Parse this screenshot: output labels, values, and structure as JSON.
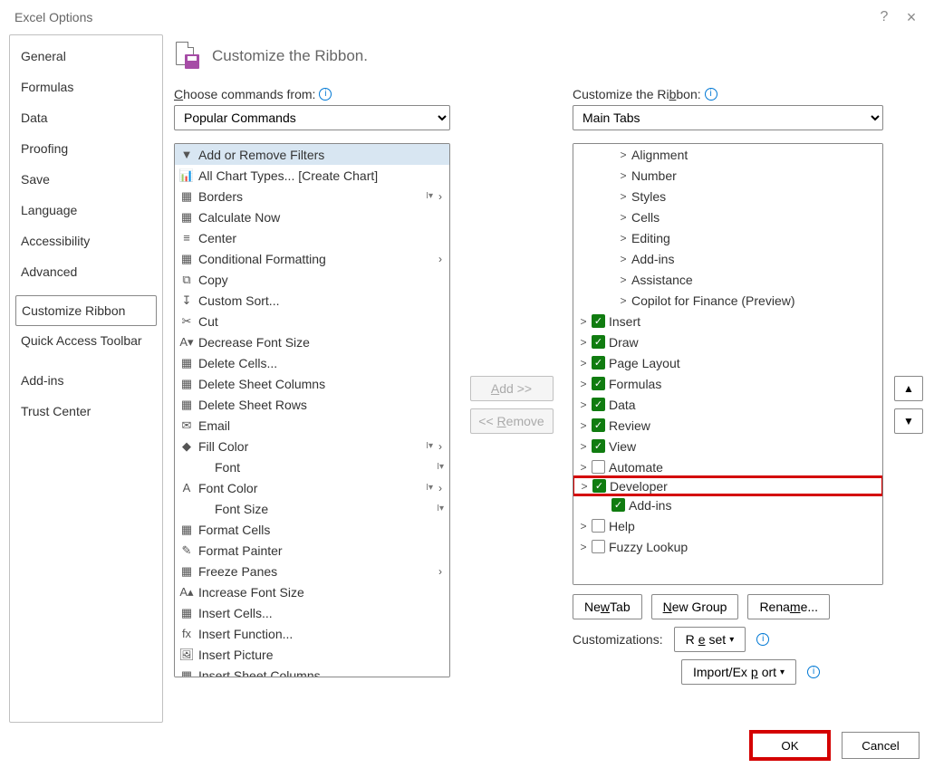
{
  "window_title": "Excel Options",
  "nav": {
    "items": [
      "General",
      "Formulas",
      "Data",
      "Proofing",
      "Save",
      "Language",
      "Accessibility",
      "Advanced",
      "Customize Ribbon",
      "Quick Access Toolbar",
      "Add-ins",
      "Trust Center"
    ],
    "selected_index": 8
  },
  "header": "Customize the Ribbon.",
  "choose_label_pre": "C",
  "choose_label_mid": "hoose commands from:",
  "choose_value": "Popular Commands",
  "customize_label_pre": "Customize the Ri",
  "customize_label_ul": "b",
  "customize_label_post": "bon:",
  "customize_value": "Main Tabs",
  "commands": [
    {
      "icon": "▼",
      "text": "Add or Remove Filters",
      "selected": true
    },
    {
      "icon": "📊",
      "text": "All Chart Types... [Create Chart]"
    },
    {
      "icon": "▦",
      "text": "Borders",
      "submenu": true,
      "split": true
    },
    {
      "icon": "▦",
      "text": "Calculate Now"
    },
    {
      "icon": "≡",
      "text": "Center"
    },
    {
      "icon": "▦",
      "text": "Conditional Formatting",
      "submenu": true
    },
    {
      "icon": "⧉",
      "text": "Copy"
    },
    {
      "icon": "↧",
      "text": "Custom Sort..."
    },
    {
      "icon": "✂",
      "text": "Cut"
    },
    {
      "icon": "A▾",
      "text": "Decrease Font Size"
    },
    {
      "icon": "▦",
      "text": "Delete Cells..."
    },
    {
      "icon": "▦",
      "text": "Delete Sheet Columns"
    },
    {
      "icon": "▦",
      "text": "Delete Sheet Rows"
    },
    {
      "icon": "✉",
      "text": "Email"
    },
    {
      "icon": "◆",
      "text": "Fill Color",
      "submenu": true,
      "split": true
    },
    {
      "icon": "",
      "text": "Font",
      "split": true,
      "indent": true
    },
    {
      "icon": "A",
      "text": "Font Color",
      "submenu": true,
      "split": true
    },
    {
      "icon": "",
      "text": "Font Size",
      "split": true,
      "indent": true
    },
    {
      "icon": "▦",
      "text": "Format Cells"
    },
    {
      "icon": "✎",
      "text": "Format Painter"
    },
    {
      "icon": "▦",
      "text": "Freeze Panes",
      "submenu": true
    },
    {
      "icon": "A▴",
      "text": "Increase Font Size"
    },
    {
      "icon": "▦",
      "text": "Insert Cells..."
    },
    {
      "icon": "fx",
      "text": "Insert Function..."
    },
    {
      "icon": "🖼",
      "text": "Insert Picture"
    },
    {
      "icon": "▦",
      "text": "Insert Sheet Columns"
    }
  ],
  "tree": [
    {
      "indent": 2,
      "caret": ">",
      "text": "Alignment"
    },
    {
      "indent": 2,
      "caret": ">",
      "text": "Number"
    },
    {
      "indent": 2,
      "caret": ">",
      "text": "Styles"
    },
    {
      "indent": 2,
      "caret": ">",
      "text": "Cells"
    },
    {
      "indent": 2,
      "caret": ">",
      "text": "Editing"
    },
    {
      "indent": 2,
      "caret": ">",
      "text": "Add-ins"
    },
    {
      "indent": 2,
      "caret": ">",
      "text": "Assistance"
    },
    {
      "indent": 2,
      "caret": ">",
      "text": "Copilot for Finance (Preview)"
    },
    {
      "indent": 0,
      "caret": ">",
      "check": true,
      "text": "Insert"
    },
    {
      "indent": 0,
      "caret": ">",
      "check": true,
      "text": "Draw"
    },
    {
      "indent": 0,
      "caret": ">",
      "check": true,
      "text": "Page Layout"
    },
    {
      "indent": 0,
      "caret": ">",
      "check": true,
      "text": "Formulas"
    },
    {
      "indent": 0,
      "caret": ">",
      "check": true,
      "text": "Data"
    },
    {
      "indent": 0,
      "caret": ">",
      "check": true,
      "text": "Review"
    },
    {
      "indent": 0,
      "caret": ">",
      "check": true,
      "text": "View"
    },
    {
      "indent": 0,
      "caret": ">",
      "check": false,
      "text": "Automate"
    },
    {
      "indent": 0,
      "caret": ">",
      "check": true,
      "text": "Developer",
      "highlight": true
    },
    {
      "indent": 1,
      "caret": "",
      "check": true,
      "text": "Add-ins"
    },
    {
      "indent": 0,
      "caret": ">",
      "check": false,
      "text": "Help"
    },
    {
      "indent": 0,
      "caret": ">",
      "check": false,
      "text": "Fuzzy Lookup"
    }
  ],
  "buttons": {
    "add": "Add >>",
    "remove": "<< Remove",
    "new_tab_pre": "Ne",
    "new_tab_ul": "w",
    "new_tab_post": " Tab",
    "new_group_pre": "",
    "new_group_ul": "N",
    "new_group_post": "ew Group",
    "rename_pre": "Rena",
    "rename_ul": "m",
    "rename_post": "e...",
    "customizations_label": "Customizations:",
    "reset_pre": "R",
    "reset_ul": "e",
    "reset_post": "set",
    "import_pre": "Import/Ex",
    "import_ul": "p",
    "import_post": "ort",
    "ok": "OK",
    "cancel": "Cancel"
  },
  "add_ul_text": "A",
  "add_rest": "dd >>",
  "remove_pre": "<< ",
  "remove_ul": "R",
  "remove_post": "emove"
}
